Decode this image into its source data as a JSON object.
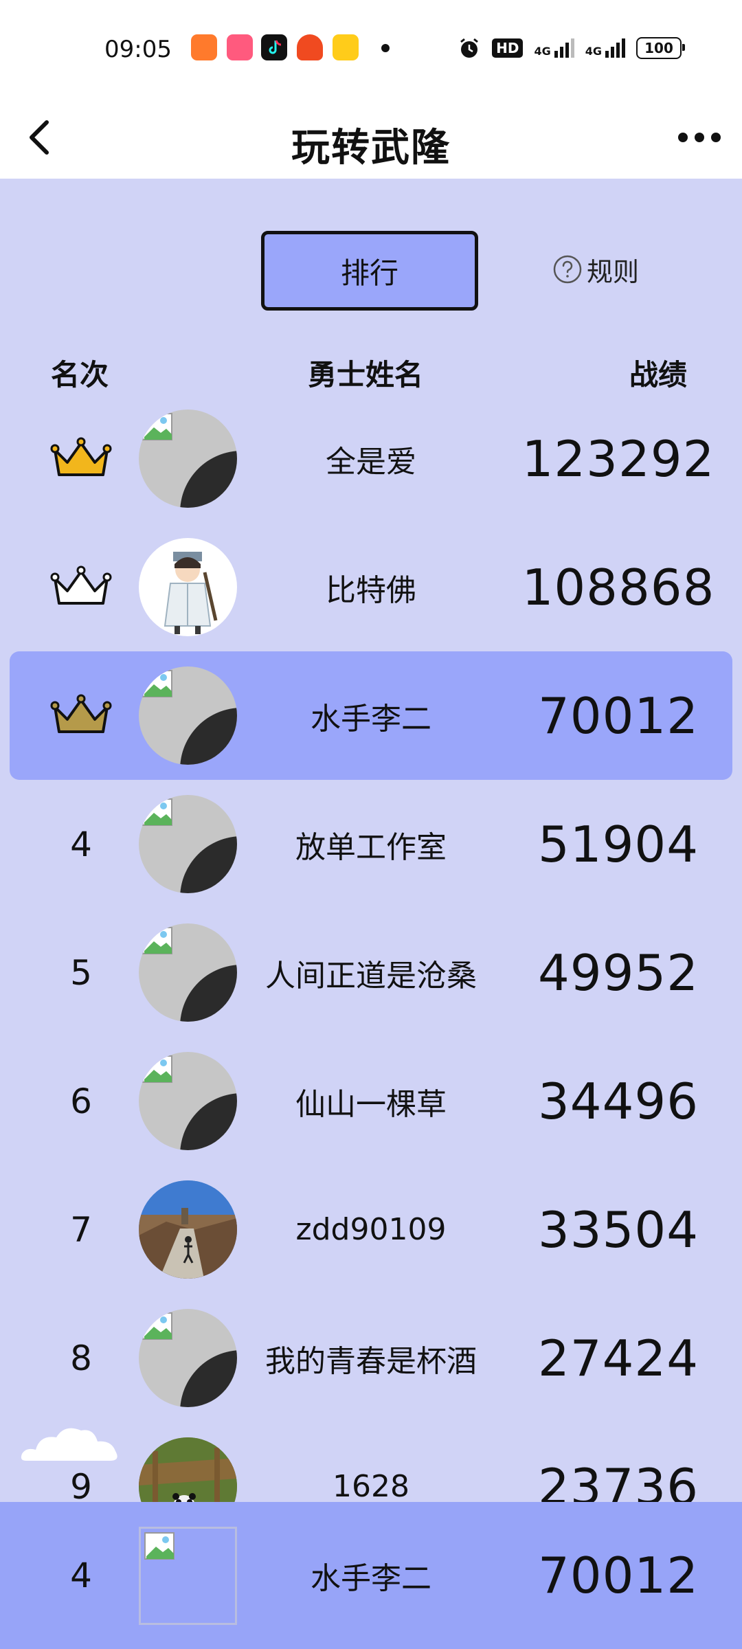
{
  "status_bar": {
    "time": "09:05",
    "battery": "100",
    "network_left": "4G",
    "network_right": "4G",
    "hd_label": "HD"
  },
  "header": {
    "title": "玩转武隆"
  },
  "tabs": {
    "ranking_label": "排行",
    "rules_label": "规则"
  },
  "columns": {
    "rank": "名次",
    "name": "勇士姓名",
    "score": "战绩"
  },
  "rows": [
    {
      "rank": "1",
      "rank_display": "gold-crown",
      "name": "全是爱",
      "score": "123292",
      "avatar": "broken-image"
    },
    {
      "rank": "2",
      "rank_display": "silver-crown",
      "name": "比特佛",
      "score": "108868",
      "avatar": "cartoon-swordsman"
    },
    {
      "rank": "3",
      "rank_display": "bronze-crown",
      "name": "水手李二",
      "score": "70012",
      "avatar": "broken-image",
      "highlighted": true
    },
    {
      "rank": "4",
      "name": "放单工作室",
      "score": "51904",
      "avatar": "broken-image"
    },
    {
      "rank": "5",
      "name": "人间正道是沧桑",
      "score": "49952",
      "avatar": "broken-image"
    },
    {
      "rank": "6",
      "name": "仙山一棵草",
      "score": "34496",
      "avatar": "broken-image"
    },
    {
      "rank": "7",
      "name": "zdd90109",
      "score": "33504",
      "avatar": "great-wall-photo"
    },
    {
      "rank": "8",
      "name": "我的青春是杯酒",
      "score": "27424",
      "avatar": "broken-image"
    },
    {
      "rank": "9",
      "name": "1628",
      "score": "23736",
      "avatar": "panda-photo"
    }
  ],
  "my_rank": {
    "rank": "4",
    "name": "水手李二",
    "score": "70012"
  },
  "colors": {
    "page_background": "#d0d3f6",
    "accent": "#9aa6fa",
    "gold_crown": "#f2b61c",
    "silver_crown": "#ffffff",
    "bronze_crown": "#b59a4a"
  }
}
